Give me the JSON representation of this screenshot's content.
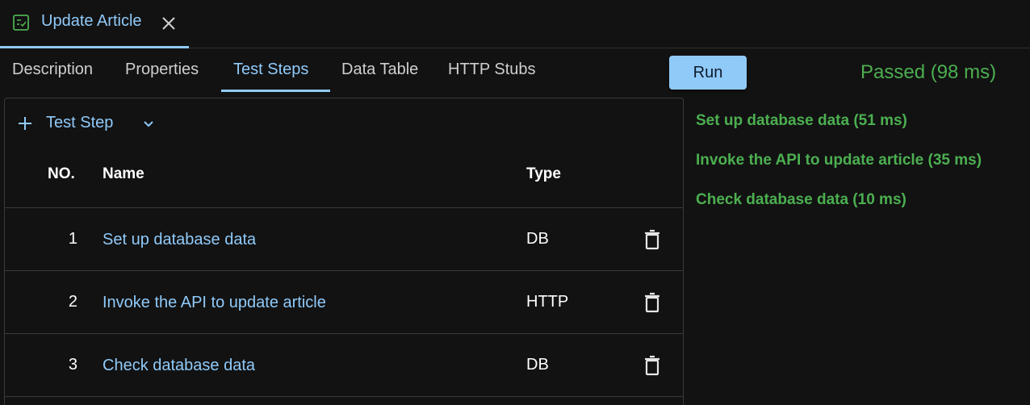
{
  "doc_tab": {
    "title": "Update Article"
  },
  "inner_tabs": [
    {
      "label": "Description"
    },
    {
      "label": "Properties"
    },
    {
      "label": "Test Steps"
    },
    {
      "label": "Data Table"
    },
    {
      "label": "HTTP Stubs"
    }
  ],
  "active_tab": "Test Steps",
  "run": {
    "label": "Run",
    "status": "Passed (98 ms)"
  },
  "steps_panel": {
    "add_label": "Test Step",
    "columns": {
      "no": "NO.",
      "name": "Name",
      "type": "Type"
    },
    "rows": [
      {
        "no": "1",
        "name": "Set up database data",
        "type": "DB"
      },
      {
        "no": "2",
        "name": "Invoke the API to update article",
        "type": "HTTP"
      },
      {
        "no": "3",
        "name": "Check database data",
        "type": "DB"
      }
    ]
  },
  "results": [
    "Set up database data (51 ms)",
    "Invoke the API to update article (35 ms)",
    "Check database data (10 ms)"
  ],
  "colors": {
    "accent": "#90caf9",
    "success": "#4caf50",
    "background": "#121212"
  },
  "icons": {
    "doc_tab": "checklist-icon",
    "close": "close-icon",
    "add": "plus-icon",
    "menu": "chevron-down-icon",
    "delete": "trash-icon"
  }
}
